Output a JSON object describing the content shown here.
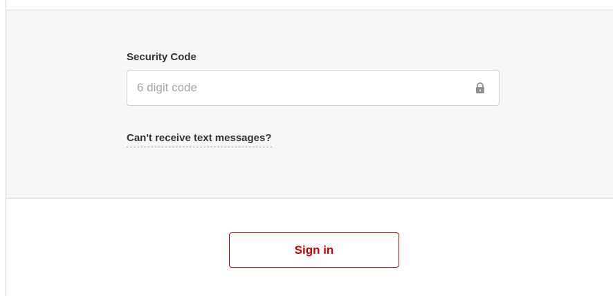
{
  "security_code": {
    "label": "Security Code",
    "value": "",
    "placeholder": "6 digit code",
    "icon": "lock-icon"
  },
  "help_link": {
    "label": "Can't receive text messages?"
  },
  "sign_in": {
    "label": "Sign in"
  },
  "colors": {
    "accent": "#cc0000",
    "panel_background": "#f7f7f7",
    "text": "#333333",
    "placeholder": "#a6a6a6"
  }
}
